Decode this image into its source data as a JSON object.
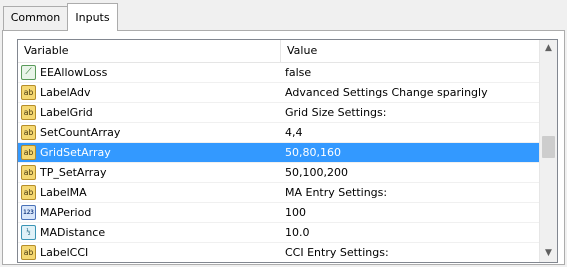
{
  "tabs": [
    {
      "label": "Common",
      "active": false
    },
    {
      "label": "Inputs",
      "active": true
    }
  ],
  "table": {
    "columns": [
      "Variable",
      "Value"
    ],
    "rows": [
      {
        "icon": "bool-icon",
        "glyph": "⟋",
        "name": "EEAllowLoss",
        "value": "false",
        "selected": false
      },
      {
        "icon": "string-icon",
        "glyph": "ab",
        "name": "LabelAdv",
        "value": "Advanced Settings Change sparingly",
        "selected": false
      },
      {
        "icon": "string-icon",
        "glyph": "ab",
        "name": "LabelGrid",
        "value": "Grid Size Settings:",
        "selected": false
      },
      {
        "icon": "string-icon",
        "glyph": "ab",
        "name": "SetCountArray",
        "value": "4,4",
        "selected": false
      },
      {
        "icon": "string-icon",
        "glyph": "ab",
        "name": "GridSetArray",
        "value": "50,80,160",
        "selected": true
      },
      {
        "icon": "string-icon",
        "glyph": "ab",
        "name": "TP_SetArray",
        "value": "50,100,200",
        "selected": false
      },
      {
        "icon": "string-icon",
        "glyph": "ab",
        "name": "LabelMA",
        "value": "MA Entry Settings:",
        "selected": false
      },
      {
        "icon": "int-icon",
        "glyph": "123",
        "name": "MAPeriod",
        "value": "100",
        "selected": false
      },
      {
        "icon": "double-icon",
        "glyph": "½",
        "name": "MADistance",
        "value": "10.0",
        "selected": false
      },
      {
        "icon": "string-icon",
        "glyph": "ab",
        "name": "LabelCCI",
        "value": "CCI Entry Settings:",
        "selected": false
      }
    ]
  },
  "scrollbar": {
    "up_glyph": "▲",
    "down_glyph": "▼"
  }
}
